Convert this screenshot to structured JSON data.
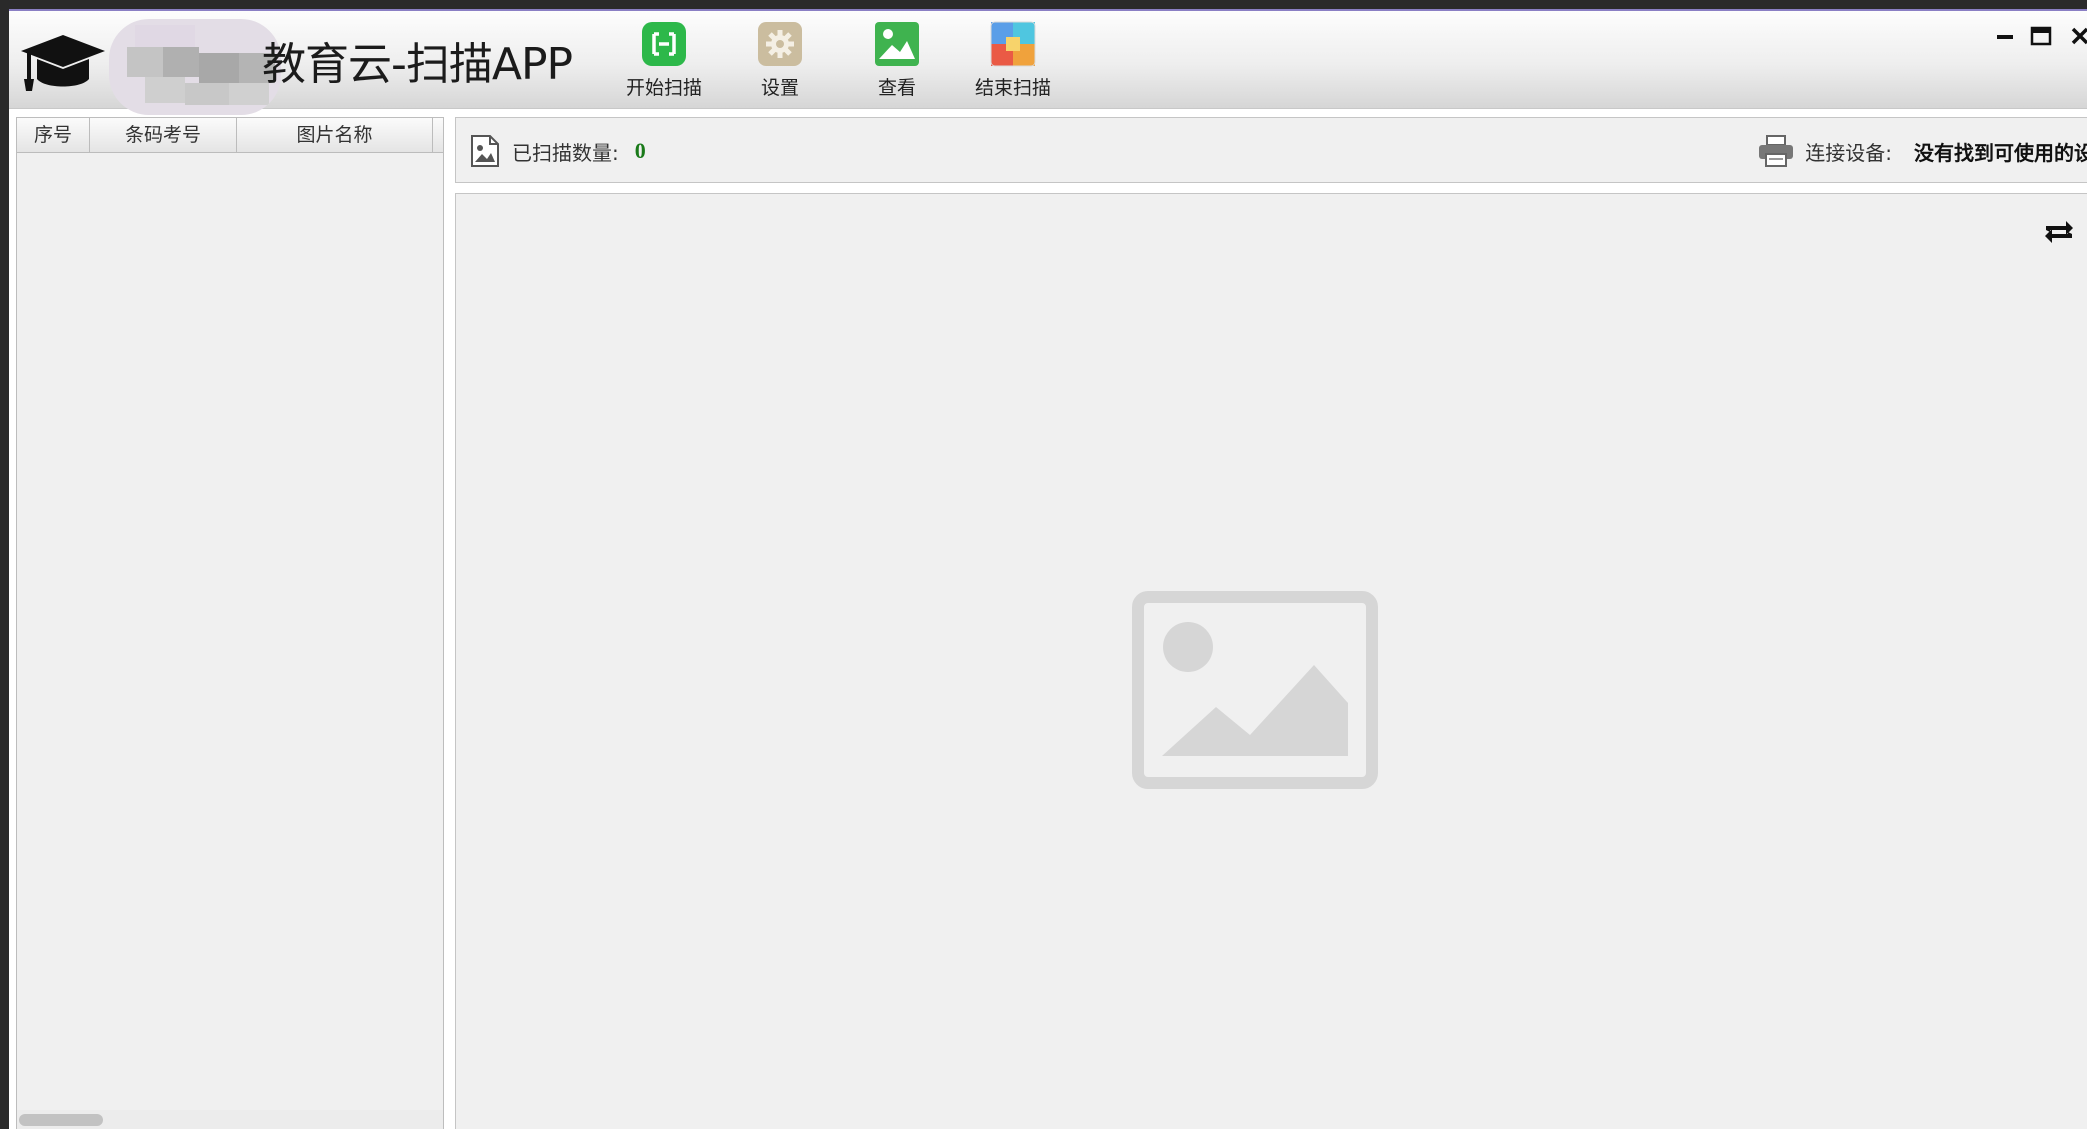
{
  "app": {
    "title": "教育云-扫描APP"
  },
  "toolbar": {
    "buttons": [
      {
        "label": "开始扫描",
        "icon": "scan-icon",
        "color": "#2db84a"
      },
      {
        "label": "设置",
        "icon": "gear-icon",
        "color": "#c9b89a"
      },
      {
        "label": "查看",
        "icon": "image-view-icon",
        "color": "#3fb34f"
      },
      {
        "label": "结束扫描",
        "icon": "stop-scan-icon",
        "color": "#ea5a45"
      }
    ]
  },
  "window_controls": {
    "minimize": "minimize-icon",
    "maximize": "maximize-icon",
    "close": "close-icon"
  },
  "file_list": {
    "columns": [
      "序号",
      "条码考号",
      "图片名称"
    ],
    "rows": []
  },
  "status": {
    "scan_count_label": "已扫描数量:",
    "scan_count_value": "0",
    "device_label": "连接设备:",
    "device_value": "没有找到可使用的设备"
  },
  "colors": {
    "accent_green": "#1a7a1a",
    "panel_bg": "#f0f0f0"
  }
}
